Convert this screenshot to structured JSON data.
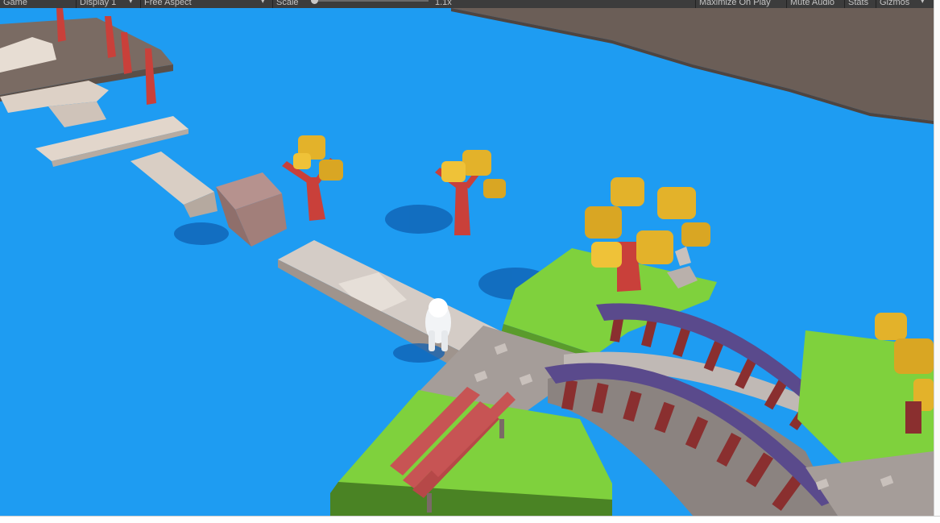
{
  "toolbar": {
    "tab_label": "Game",
    "display_label": "Display 1",
    "aspect_label": "Free Aspect",
    "scale_label": "Scale",
    "scale_value": "1.1x",
    "maximize_label": "Maximize On Play",
    "mute_label": "Mute Audio",
    "stats_label": "Stats",
    "gizmos_label": "Gizmos"
  },
  "scene": {
    "colors": {
      "water": "#1e9cf2",
      "sky": "#6b5e57",
      "grass": "#7fd13d",
      "stone": "#a59d99",
      "tree_trunk": "#c9403a",
      "foliage": "#e3b22a",
      "bridge_rail": "#5a4a8c",
      "bridge_post": "#8a2f2f",
      "bench": "#c75454"
    }
  }
}
